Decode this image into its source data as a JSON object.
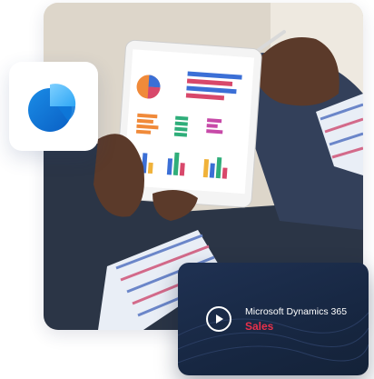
{
  "video_card": {
    "title": "Microsoft Dynamics 365",
    "subtitle": "Sales",
    "play_icon": "play-circle-icon",
    "subtitle_color": "#e8304a"
  },
  "logo": {
    "icon": "dynamics-365-sales-logo-icon"
  },
  "photo": {
    "description_icon": "tablet-with-charts-photo"
  }
}
